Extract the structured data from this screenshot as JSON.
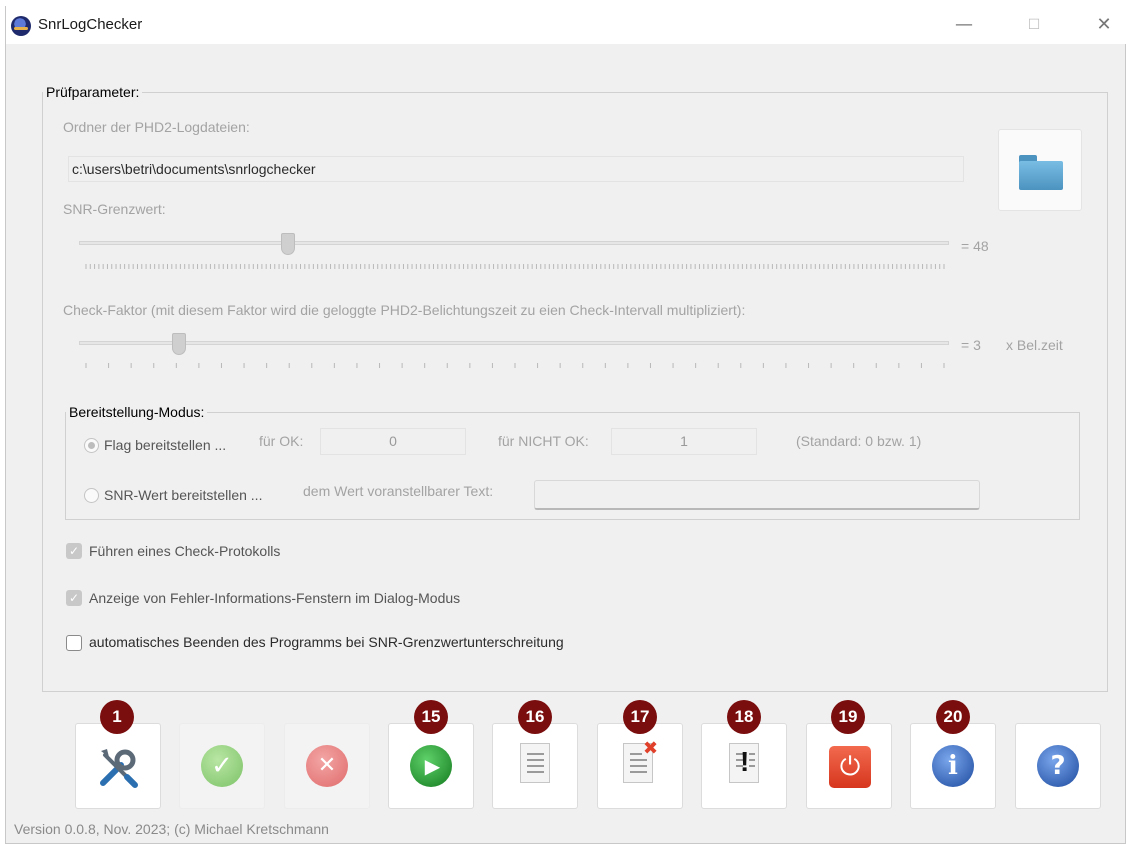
{
  "window": {
    "title": "SnrLogChecker",
    "minimize_glyph": "—",
    "maximize_glyph": "☐",
    "close_glyph": "✕"
  },
  "params": {
    "legend": "Prüfparameter:",
    "folder_label": "Ordner der PHD2-Logdateien:",
    "folder_path": "c:\\users\\betri\\documents\\snrlogchecker",
    "folder_icon": "folder-icon",
    "snr_label": "SNR-Grenzwert:",
    "snr_value": 48,
    "snr_value_text": "= 48",
    "snr_min": 0,
    "snr_max": 200,
    "check_label": "Check-Faktor (mit diesem Faktor wird die geloggte PHD2-Belichtungszeit zu eien Check-Intervall multipliziert):",
    "check_value": 3,
    "check_value_text": "= 3",
    "check_unit": "x Bel.zeit",
    "check_min": 1,
    "check_max": 20
  },
  "mode": {
    "legend": "Bereitstellung-Modus:",
    "flag_label": "Flag bereitstellen ...",
    "flag_selected": true,
    "ok_label": "für OK:",
    "ok_value": "0",
    "notok_label": "für NICHT OK:",
    "notok_value": "1",
    "standard_note": "(Standard: 0 bzw. 1)",
    "snr_label": "SNR-Wert bereitstellen ...",
    "snr_selected": false,
    "prefix_label": "dem Wert voranstellbarer Text:",
    "prefix_value": ""
  },
  "options": [
    {
      "label": "Führen eines Check-Protokolls",
      "checked": true
    },
    {
      "label": "Anzeige von Fehler-Informations-Fenstern im Dialog-Modus",
      "checked": true
    },
    {
      "label": "automatisches Beenden des Programms bei SNR-Grenzwertunterschreitung",
      "checked": false
    }
  ],
  "toolbar": {
    "badges": [
      "1",
      "15",
      "16",
      "17",
      "18",
      "19",
      "20"
    ],
    "buttons": [
      "settings-icon",
      "confirm-icon",
      "cancel-icon",
      "play-icon",
      "log-icon",
      "delete-log-icon",
      "alert-log-icon",
      "power-icon",
      "info-icon",
      "help-icon"
    ],
    "confirm_glyph": "✓",
    "cancel_glyph": "✕",
    "play_glyph": "▶",
    "info_glyph": "i",
    "help_glyph": "?",
    "delete_glyph": "✖",
    "alert_glyph": "!",
    "power_glyph": "⏻",
    "brand_colors": {
      "badge": "#7a0d0d",
      "play": "#1f8f2a",
      "power": "#e0402a",
      "info": "#2a5db0"
    }
  },
  "footer": "Version 0.0.8, Nov. 2023; (c) Michael Kretschmann"
}
